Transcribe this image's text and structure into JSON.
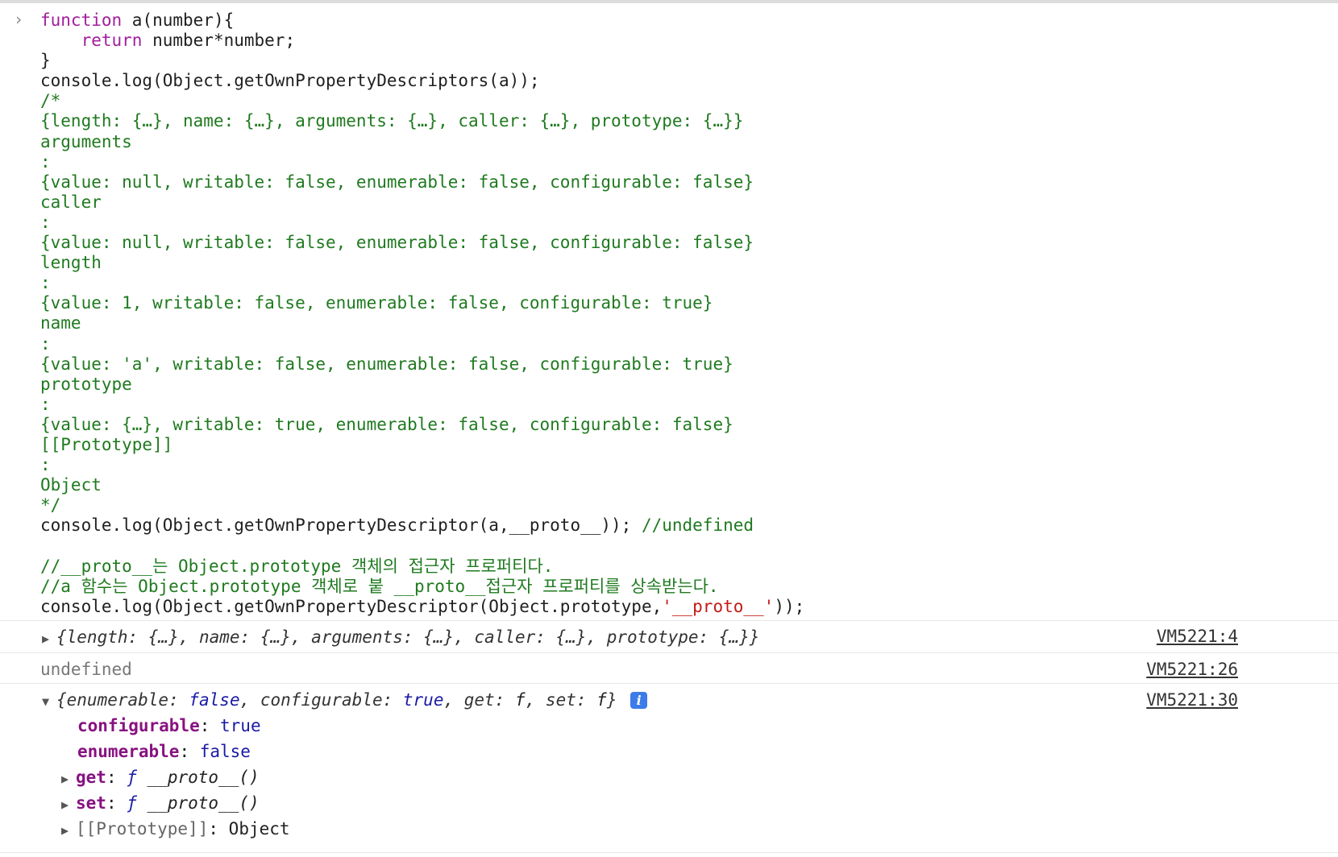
{
  "prompt_symbol": "›",
  "code": {
    "l1_kw": "function",
    "l1_rest": " a(number){",
    "l2_kw": "    return",
    "l2_rest": " number*number;",
    "l3": "}",
    "l4": "console.log(Object.getOwnPropertyDescriptors(a));",
    "c1": "/*",
    "c2": "{length: {…}, name: {…}, arguments: {…}, caller: {…}, prototype: {…}}",
    "c3": "arguments",
    "c4": ":",
    "c5": "{value: null, writable: false, enumerable: false, configurable: false}",
    "c6": "caller",
    "c7": ":",
    "c8": "{value: null, writable: false, enumerable: false, configurable: false}",
    "c9": "length",
    "c10": ":",
    "c11": "{value: 1, writable: false, enumerable: false, configurable: true}",
    "c12": "name",
    "c13": ":",
    "c14": "{value: 'a', writable: false, enumerable: false, configurable: true}",
    "c15": "prototype",
    "c16": ":",
    "c17": "{value: {…}, writable: true, enumerable: false, configurable: false}",
    "c18": "[[Prototype]]",
    "c19": ":",
    "c20": "Object",
    "c21": "*/",
    "l5_code": "console.log(Object.getOwnPropertyDescriptor(a,__proto__)); ",
    "l5_comment": "//undefined",
    "k1": "//__proto__는 Object.prototype 객체의 접근자 프로퍼티다.",
    "k2": "//a 함수는 Object.prototype 객체로 붙 __proto__접근자 프로퍼티를 상속받는다.",
    "l6_pre": "console.log(Object.getOwnPropertyDescriptor(Object.prototype,",
    "l6_str": "'__proto__'",
    "l6_post": "));"
  },
  "outputs": {
    "o1_text": "{length: {…}, name: {…}, arguments: {…}, caller: {…}, prototype: {…}}",
    "o1_src": "VM5221:4",
    "o2_text": "undefined",
    "o2_src": "VM5221:26",
    "o3_pre": "{enumerable: ",
    "o3_v1": "false",
    "o3_mid1": ", configurable: ",
    "o3_v2": "true",
    "o3_mid2": ", get: ",
    "o3_f1": "f",
    "o3_mid3": ", set: ",
    "o3_f2": "f",
    "o3_end": "}",
    "o3_info": "i",
    "o3_src": "VM5221:30",
    "props": {
      "configurable_key": "configurable",
      "configurable_val": "true",
      "enumerable_key": "enumerable",
      "enumerable_val": "false",
      "get_key": "get",
      "get_f": "ƒ",
      "get_name": "__proto__()",
      "set_key": "set",
      "set_f": "ƒ",
      "set_name": "__proto__()",
      "proto_key": "[[Prototype]]",
      "proto_val": "Object"
    }
  },
  "colors": {
    "keyword": "#a21d9d",
    "comment": "#1f7a1f",
    "string": "#c41a16",
    "property_key": "#881280",
    "boolean": "#1a1aa6",
    "info_badge": "#3c7be8"
  },
  "icons": [
    "prompt-chevron-icon",
    "expand-triangle-icon",
    "collapse-triangle-icon",
    "info-icon"
  ]
}
